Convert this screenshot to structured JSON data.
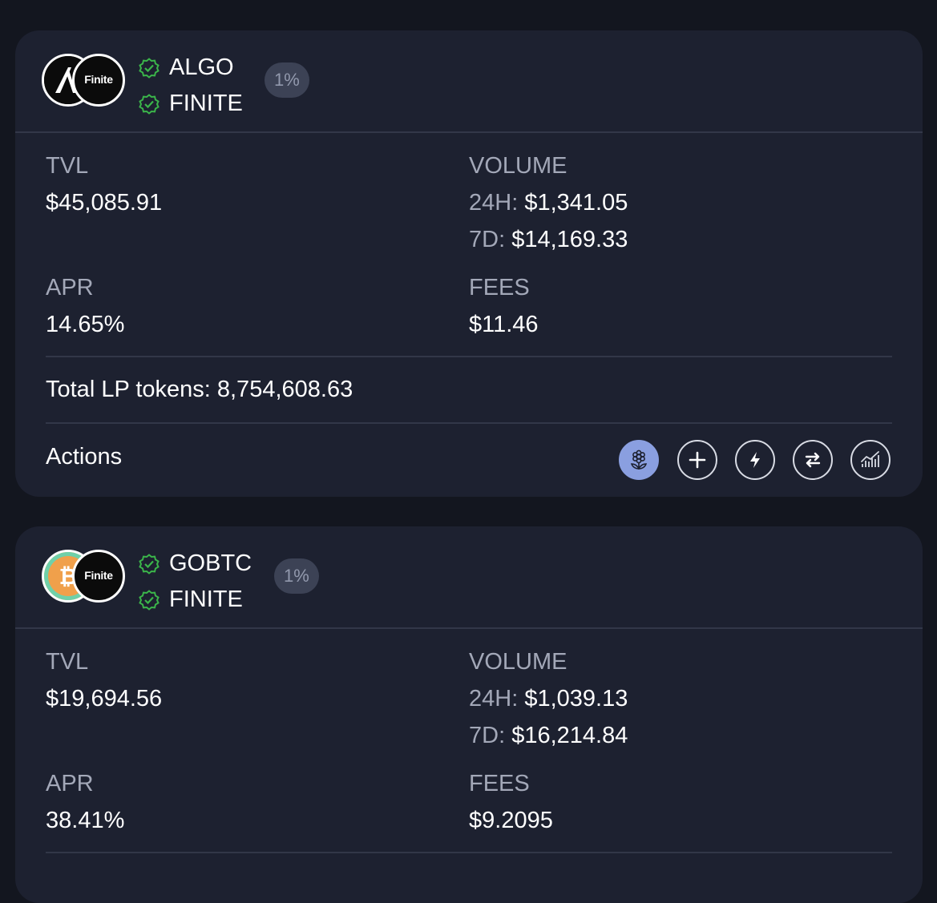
{
  "pools": [
    {
      "assets": [
        "ALGO",
        "FINITE"
      ],
      "logos": [
        "algo-logo",
        "Finite"
      ],
      "fee": "1%",
      "tvl_label": "TVL",
      "tvl": "$45,085.91",
      "volume_label": "VOLUME",
      "volume_24h_label": "24H:",
      "volume_24h": "$1,341.05",
      "volume_7d_label": "7D:",
      "volume_7d": "$14,169.33",
      "apr_label": "APR",
      "apr": "14.65%",
      "fees_label": "FEES",
      "fees": "$11.46",
      "lp_tokens_text": "Total LP tokens: 8,754,608.63",
      "actions_label": "Actions",
      "actions": [
        "farm-icon",
        "add-liquidity-icon",
        "zap-icon",
        "swap-icon",
        "analytics-icon"
      ]
    },
    {
      "assets": [
        "GOBTC",
        "FINITE"
      ],
      "logos": [
        "gobtc-logo",
        "Finite"
      ],
      "fee": "1%",
      "tvl_label": "TVL",
      "tvl": "$19,694.56",
      "volume_label": "VOLUME",
      "volume_24h_label": "24H:",
      "volume_24h": "$1,039.13",
      "volume_7d_label": "7D:",
      "volume_7d": "$16,214.84",
      "apr_label": "APR",
      "apr": "38.41%",
      "fees_label": "FEES",
      "fees": "$9.2095"
    }
  ],
  "colors": {
    "background": "#13161f",
    "card": "#1d2130",
    "verified": "#3bb54a",
    "active_action": "#8a9fe0",
    "muted_text": "#a3a8b8"
  }
}
